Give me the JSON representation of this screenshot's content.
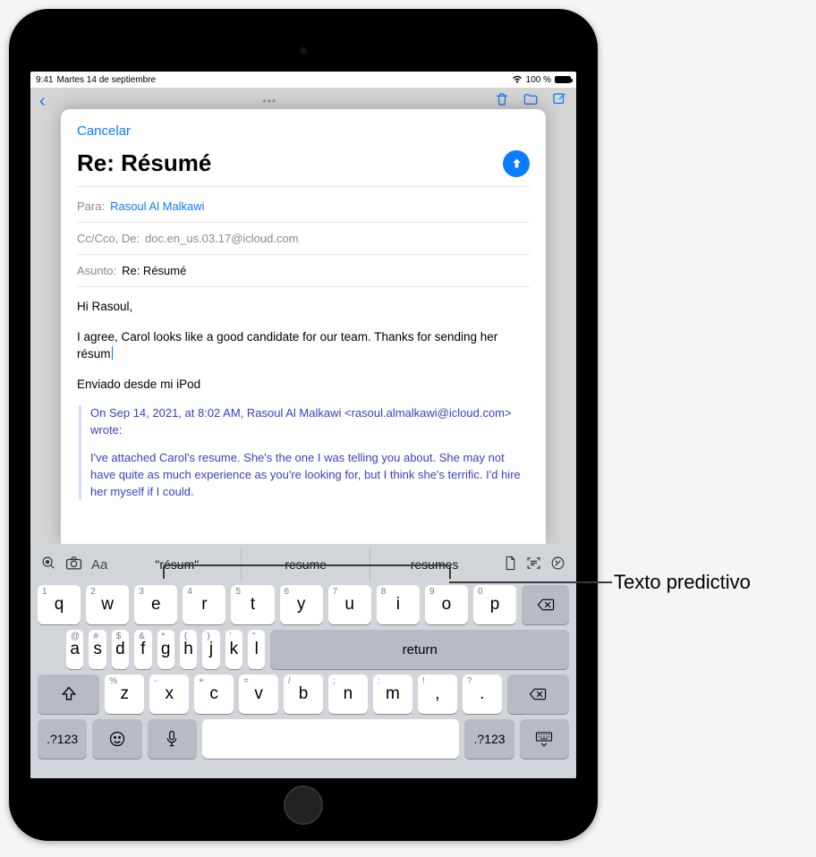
{
  "status": {
    "time": "9:41",
    "date": "Martes 14 de septiembre",
    "battery_pct": "100 %",
    "wifi": true
  },
  "mail_bg": {
    "back": "‹",
    "more": "•••"
  },
  "compose": {
    "cancel": "Cancelar",
    "title": "Re: Résumé",
    "to_label": "Para:",
    "to_value": "Rasoul Al Malkawi",
    "cc_label": "Cc/Cco, De:",
    "cc_value": "doc.en_us.03.17@icloud.com",
    "subject_label": "Asunto:",
    "subject_value": "Re: Résumé",
    "body_greeting": "Hi Rasoul,",
    "body_line": "I agree, Carol looks like a good candidate for our team. Thanks for sending her résum",
    "signature": "Enviado desde mi iPod",
    "quote_header": "On Sep 14, 2021, at 8:02 AM, Rasoul Al Malkawi <rasoul.almalkawi@icloud.com> wrote:",
    "quote_body": "I've attached Carol's resume. She's the one I was telling you about. She may not have quite as much experience as you're looking for, but I think she's terrific. I'd hire her myself if I could."
  },
  "predictive": {
    "s1": "\"résum\"",
    "s2": "resume",
    "s3": "resumes"
  },
  "toolbar_icons": {
    "emoji_globe": "emoji-picker",
    "camera": "camera",
    "aa": "Aa",
    "doc": "document",
    "scan": "scan-text",
    "markup": "markup"
  },
  "keyboard": {
    "row1": [
      {
        "main": "q",
        "alt": "1"
      },
      {
        "main": "w",
        "alt": "2"
      },
      {
        "main": "e",
        "alt": "3"
      },
      {
        "main": "r",
        "alt": "4"
      },
      {
        "main": "t",
        "alt": "5"
      },
      {
        "main": "y",
        "alt": "6"
      },
      {
        "main": "u",
        "alt": "7"
      },
      {
        "main": "i",
        "alt": "8"
      },
      {
        "main": "o",
        "alt": "9"
      },
      {
        "main": "p",
        "alt": "0"
      }
    ],
    "row2": [
      {
        "main": "a",
        "alt": "@"
      },
      {
        "main": "s",
        "alt": "#"
      },
      {
        "main": "d",
        "alt": "$"
      },
      {
        "main": "f",
        "alt": "&"
      },
      {
        "main": "g",
        "alt": "*"
      },
      {
        "main": "h",
        "alt": "("
      },
      {
        "main": "j",
        "alt": ")"
      },
      {
        "main": "k",
        "alt": "'"
      },
      {
        "main": "l",
        "alt": "\""
      }
    ],
    "row3": [
      {
        "main": "z",
        "alt": "%"
      },
      {
        "main": "x",
        "alt": "-"
      },
      {
        "main": "c",
        "alt": "+"
      },
      {
        "main": "v",
        "alt": "="
      },
      {
        "main": "b",
        "alt": "/"
      },
      {
        "main": "n",
        "alt": ";"
      },
      {
        "main": "m",
        "alt": ":"
      },
      {
        "main": ",",
        "alt": "!"
      },
      {
        "main": ".",
        "alt": "?"
      }
    ],
    "return": "return",
    "numkey": ".?123",
    "shift": "shift",
    "delete": "delete",
    "emoji": "emoji",
    "mic": "dictate",
    "hidekb": "hide-keyboard"
  },
  "callout": {
    "label": "Texto predictivo"
  }
}
